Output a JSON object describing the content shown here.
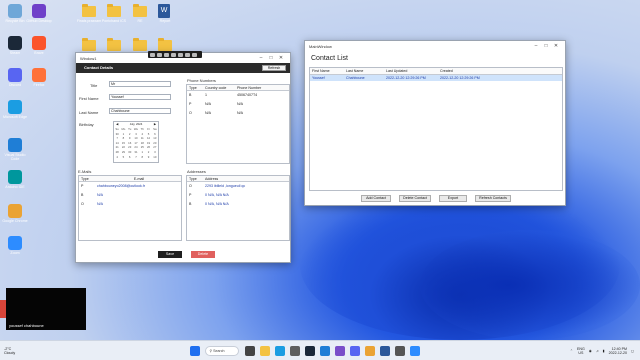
{
  "desktop": {
    "icons": [
      {
        "label": "Recycle Bin",
        "color": "#6fa7d8"
      },
      {
        "label": "Steam",
        "color": "#1b2838"
      },
      {
        "label": "Discord",
        "color": "#5865f2"
      },
      {
        "label": "Microsoft Edge",
        "color": "#1b9de2"
      },
      {
        "label": "Visual Studio Code",
        "color": "#1f7ed6"
      },
      {
        "label": "Arduino IDE",
        "color": "#00979d"
      },
      {
        "label": "Google Chrome",
        "color": "#eaa334"
      },
      {
        "label": "Zoom",
        "color": "#2d8cff"
      },
      {
        "label": "GitHub Desktop",
        "color": "#6e40c9"
      },
      {
        "label": "Brave",
        "color": "#fb542b"
      },
      {
        "label": "Firefox",
        "color": "#ff7139"
      }
    ],
    "top_folders": [
      "Finals praxxam",
      "Pontchand ICS",
      "RE",
      "Report"
    ]
  },
  "contact_details": {
    "window_title": "Window1",
    "header": "Contact Details",
    "refresh_label": "Refresh",
    "title_label": "Title",
    "title_value": "Mr",
    "first_name_label": "First Name",
    "first_name_value": "Youssef",
    "last_name_label": "Last Name",
    "last_name_value": "Chahboune",
    "birthday_label": "Birthday",
    "calendar": {
      "month": "July, 2024",
      "weekdays": [
        "Su",
        "Mo",
        "Tu",
        "We",
        "Th",
        "Fr",
        "Sa"
      ],
      "days": [
        "30",
        "1",
        "2",
        "3",
        "4",
        "5",
        "6",
        "7",
        "8",
        "9",
        "10",
        "11",
        "12",
        "13",
        "14",
        "15",
        "16",
        "17",
        "18",
        "19",
        "20",
        "21",
        "22",
        "23",
        "24",
        "25",
        "26",
        "27",
        "28",
        "29",
        "30",
        "31",
        "1",
        "2",
        "3",
        "4",
        "5",
        "6",
        "7",
        "8",
        "9",
        "10"
      ]
    },
    "phone_numbers": {
      "group_label": "Phone Numbers",
      "columns": [
        "Type",
        "Country code",
        "Phone Number"
      ],
      "rows": [
        {
          "type": "B",
          "country_code": "1",
          "number": "45067407T4"
        },
        {
          "type": "P",
          "country_code": "N/A",
          "number": "N/A"
        },
        {
          "type": "O",
          "country_code": "N/A",
          "number": "N/A"
        }
      ]
    },
    "emails": {
      "group_label": "E-Mails",
      "columns": [
        "Type",
        "E-mail"
      ],
      "rows": [
        {
          "type": "P",
          "email": "chahbouneyo2008@outlook.fr"
        },
        {
          "type": "B",
          "email": "N/A"
        },
        {
          "type": "O",
          "email": "N/A"
        }
      ]
    },
    "addresses": {
      "group_label": "Addresses",
      "columns": [
        "Type",
        "Address"
      ],
      "rows": [
        {
          "type": "O",
          "address": "2293 ibilleld ,longueuil qc"
        },
        {
          "type": "P",
          "address": "0 N/A, N/A N/A"
        },
        {
          "type": "B",
          "address": "0 N/A, N/A N/A"
        }
      ]
    },
    "save_label": "Save",
    "delete_label": "Delete"
  },
  "contact_list": {
    "window_title": "MainWindow",
    "header": "Contact List",
    "columns": [
      "First Name",
      "Last Name",
      "Last Updated",
      "Created"
    ],
    "rows": [
      {
        "first_name": "Youssef",
        "last_name": "Chahboune",
        "last_updated": "2022-12-20 12:29:26 PM",
        "created": "2022-12-20 12:29:26 PM"
      }
    ],
    "add_label": "Add Contact",
    "delete_label": "Delete Contact",
    "export_label": "Export",
    "refresh_label": "Refresh Contacts"
  },
  "webcam": {
    "caption": "youssef chahboune"
  },
  "taskbar": {
    "weather_temp": "-2°C",
    "weather_desc": "Cloudy",
    "search_label": "Search",
    "language": "ENG",
    "region": "US",
    "time": "12:40 PM",
    "date": "2022-12-20"
  }
}
